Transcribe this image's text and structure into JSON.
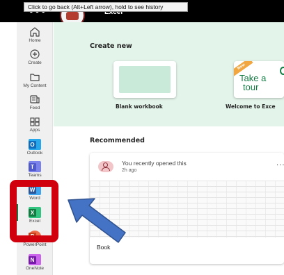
{
  "topbar": {
    "menu_glyph": "•••",
    "app_name": "Excel",
    "tooltip": "Click to go back (Alt+Left arrow), hold to see history"
  },
  "sidebar": {
    "items": [
      {
        "label": "Home",
        "icon": "home-icon"
      },
      {
        "label": "Create",
        "icon": "plus-circle-icon"
      },
      {
        "label": "My Content",
        "icon": "folder-icon"
      },
      {
        "label": "Feed",
        "icon": "feed-icon"
      },
      {
        "label": "Apps",
        "icon": "apps-icon"
      },
      {
        "label": "Outlook",
        "icon": "outlook-icon",
        "letter": "O",
        "color": "#0f6cbd"
      },
      {
        "label": "Teams",
        "icon": "teams-icon",
        "letter": "T",
        "color": "#5059c9"
      },
      {
        "label": "Word",
        "icon": "word-icon",
        "letter": "W",
        "color": "#2b579a"
      },
      {
        "label": "Excel",
        "icon": "excel-icon",
        "letter": "X",
        "color": "#107c41",
        "active": true
      },
      {
        "label": "PowerPoint",
        "icon": "powerpoint-icon",
        "letter": "P",
        "color": "#c43e1c"
      },
      {
        "label": "OneNote",
        "icon": "onenote-icon",
        "letter": "N",
        "color": "#7719aa"
      }
    ]
  },
  "main": {
    "create_new_heading": "Create new",
    "templates": [
      {
        "label": "Blank workbook"
      },
      {
        "label": "Welcome to Exce",
        "thumb_text_line1": "Take a",
        "thumb_text_line2": "tour",
        "badge": "New"
      }
    ],
    "recommended_heading": "Recommended",
    "recommended_card": {
      "activity": "You recently opened this",
      "time": "2h ago",
      "more_glyph": "...",
      "file_name": "Book"
    }
  },
  "colors": {
    "banner": "#e3f4ea",
    "excel_green": "#107c41",
    "highlight_red": "#d1000d",
    "arrow_blue": "#4472c4"
  }
}
